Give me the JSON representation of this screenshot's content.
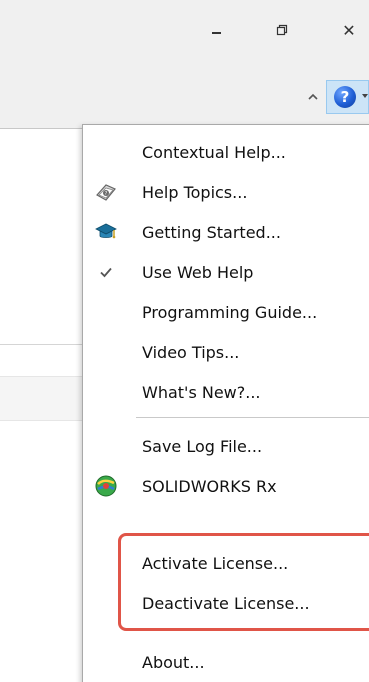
{
  "window": {
    "minimize_icon": "minimize-icon",
    "restore_icon": "restore-icon",
    "close_glyph": "✕"
  },
  "toolbar": {
    "help_glyph": "?",
    "collapse_icon": "chevron-up-icon"
  },
  "help_menu": {
    "items": [
      {
        "label": "Contextual Help...",
        "icon": ""
      },
      {
        "label": "Help Topics...",
        "icon": "help-book-icon"
      },
      {
        "label": "Getting Started...",
        "icon": "graduation-cap-icon"
      },
      {
        "label": "Use Web Help",
        "icon": "check-icon"
      },
      {
        "label": "Programming Guide...",
        "icon": ""
      },
      {
        "label": "Video Tips...",
        "icon": ""
      },
      {
        "label": "What's New?...",
        "icon": ""
      },
      {
        "label": "Save Log File...",
        "icon": ""
      },
      {
        "label": "SOLIDWORKS Rx",
        "icon": "solidworks-rx-icon"
      },
      {
        "label": "Activate License...",
        "icon": ""
      },
      {
        "label": "Deactivate License...",
        "icon": ""
      },
      {
        "label": "About...",
        "icon": ""
      }
    ]
  },
  "colors": {
    "highlight": "#e05548",
    "help_button_bg": "#cce4f7",
    "help_icon_blue": "#1f5fd6"
  }
}
